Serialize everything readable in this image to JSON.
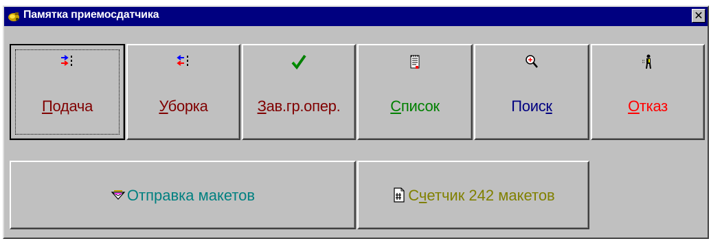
{
  "window": {
    "title": "Памятка приемосдатчика",
    "title_icon": "app-icon",
    "close_glyph": "✕"
  },
  "buttons": [
    {
      "id": "podacha",
      "pre": "",
      "hot": "П",
      "post": "одача",
      "color": "#800000",
      "icon": "arrows-in-icon"
    },
    {
      "id": "uborka",
      "pre": "",
      "hot": "У",
      "post": "борка",
      "color": "#800000",
      "icon": "arrows-out-icon"
    },
    {
      "id": "zav",
      "pre": "",
      "hot": "З",
      "post": "ав.гр.опер.",
      "color": "#800000",
      "icon": "checkmark-icon"
    },
    {
      "id": "spisok",
      "pre": "",
      "hot": "С",
      "post": "писок",
      "color": "#008000",
      "icon": "notepad-icon"
    },
    {
      "id": "poisk",
      "pre": "Поис",
      "hot": "к",
      "post": "",
      "color": "#000080",
      "icon": "magnifier-icon"
    },
    {
      "id": "otkaz",
      "pre": "",
      "hot": "О",
      "post": "тказ",
      "color": "#ff0000",
      "icon": "person-icon"
    }
  ],
  "wide_buttons": [
    {
      "id": "otpravka",
      "pre": "Отправка макетов",
      "hot": "",
      "post": "",
      "color": "#008080",
      "icon": "envelope-icon"
    },
    {
      "id": "schetchik",
      "pre": "С",
      "hot": "ч",
      "post": "етчик 242 макетов",
      "color": "#808000",
      "icon": "counter-doc-icon"
    }
  ],
  "colors": {
    "title_bg": "#000080",
    "face": "#c0c0c0"
  }
}
